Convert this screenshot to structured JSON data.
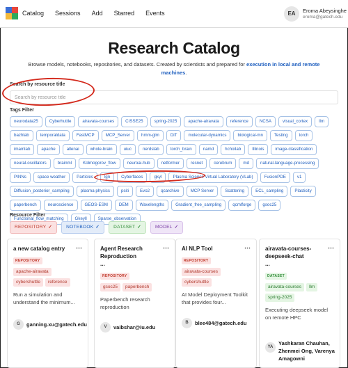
{
  "nav": {
    "items": [
      "Catalog",
      "Sessions",
      "Add",
      "Starred",
      "Events"
    ]
  },
  "user": {
    "initials": "EA",
    "name": "Eroma Abeysinghe",
    "email": "eroma@gatech.edu"
  },
  "hero": {
    "title": "Research Catalog",
    "subtitle_text": "Browse models, notebooks, repositories, and datasets. Created by scientists and prepared for ",
    "subtitle_link": "execution in local and remote machines",
    "subtitle_end": "."
  },
  "search": {
    "label": "Search by resource title",
    "placeholder": "Search by resource title"
  },
  "tags": {
    "label": "Tags Filter",
    "items": [
      "neurodata25",
      "Cyberhuttle",
      "airavata-courses",
      "CISSE25",
      "spring-2025",
      "apache-airavata",
      "reference",
      "NCSA",
      "visual_cortex",
      "llm",
      "bazhlab",
      "temporaldata",
      "FastMCP",
      "MCP_Server",
      "hmm-glm",
      "DiT",
      "molecular-dynamics",
      "biological-mn",
      "Testing",
      "torch",
      "imamlab",
      "apache",
      "allenai",
      "whole-brain",
      "uiuc",
      "nerdslab",
      "torch_brain",
      "namd",
      "hchoilab",
      "Illinois",
      "image-classification",
      "neural-oscillators",
      "brainml",
      "Kolmogorov_flow",
      "neuroai-hub",
      "netformer",
      "resnet",
      "cerebrum",
      "md",
      "natural-language-processing",
      "PINNs",
      "space weather",
      "Particles",
      "lgn",
      "Cyberfaces",
      "gkyl",
      "Plasma Science Virtual Laboratory (VLab)",
      "FusionPDE",
      "v1",
      "Diffusion_posterior_sampling",
      "plasma physics",
      "psiti",
      "Evo2",
      "qcarchive",
      "MCP Server",
      "Scattering",
      "ECL_sampling",
      "Plasticity",
      "paperbench",
      "neuroscience",
      "GEOS-ESM",
      "DEM",
      "Wavelengths",
      "Gradient_free_sampling",
      "qcmlforge",
      "gsoc25",
      "Functional_flow_matching",
      "Gkeyll",
      "Sparse_observation"
    ]
  },
  "resource_filter": {
    "label": "Resource Filter",
    "options": [
      {
        "label": "REPOSITORY",
        "check": "✓"
      },
      {
        "label": "NOTEBOOK",
        "check": "✓"
      },
      {
        "label": "DATASET",
        "check": "✓"
      },
      {
        "label": "MODEL",
        "check": "✓"
      }
    ]
  },
  "cards": [
    {
      "title": "a new catalog entry",
      "type": "REPOSITORY",
      "tags": [
        "apache-airavata",
        "cybershuttle",
        "reference"
      ],
      "description": "Run a simulation and understand the minimum...",
      "owner_initial": "G",
      "owner": "ganning.xu@gatech.edu"
    },
    {
      "title": "Agent Research Reproduction",
      "title_more": "...",
      "type": "REPOSITORY",
      "tags": [
        "gsoc25",
        "paperbench"
      ],
      "description": "Paperbench research reproduction",
      "owner_initial": "V",
      "owner": "vaibshar@iu.edu"
    },
    {
      "title": "AI NLP Tool",
      "type": "REPOSITORY",
      "tags": [
        "airavata-courses",
        "cybershuttle"
      ],
      "description": "AI Model Deployment Toolkit that provides four...",
      "owner_initial": "B",
      "owner": "blee484@gatech.edu"
    },
    {
      "title": "airavata-courses-deepseek-chat",
      "title_more": "...",
      "type": "DATASET",
      "tags": [
        "airavata-courses",
        "llm",
        "spring-2025"
      ],
      "description": "Executing deepseek model on remote HPC",
      "owner_initial": "YA",
      "owner": "Yashkaran Chauhan, Zhenmei Ong, Varenya Amagowni"
    }
  ],
  "colors": {
    "annotation_red": "#d42b1e",
    "link_blue": "#1f5fbf"
  }
}
